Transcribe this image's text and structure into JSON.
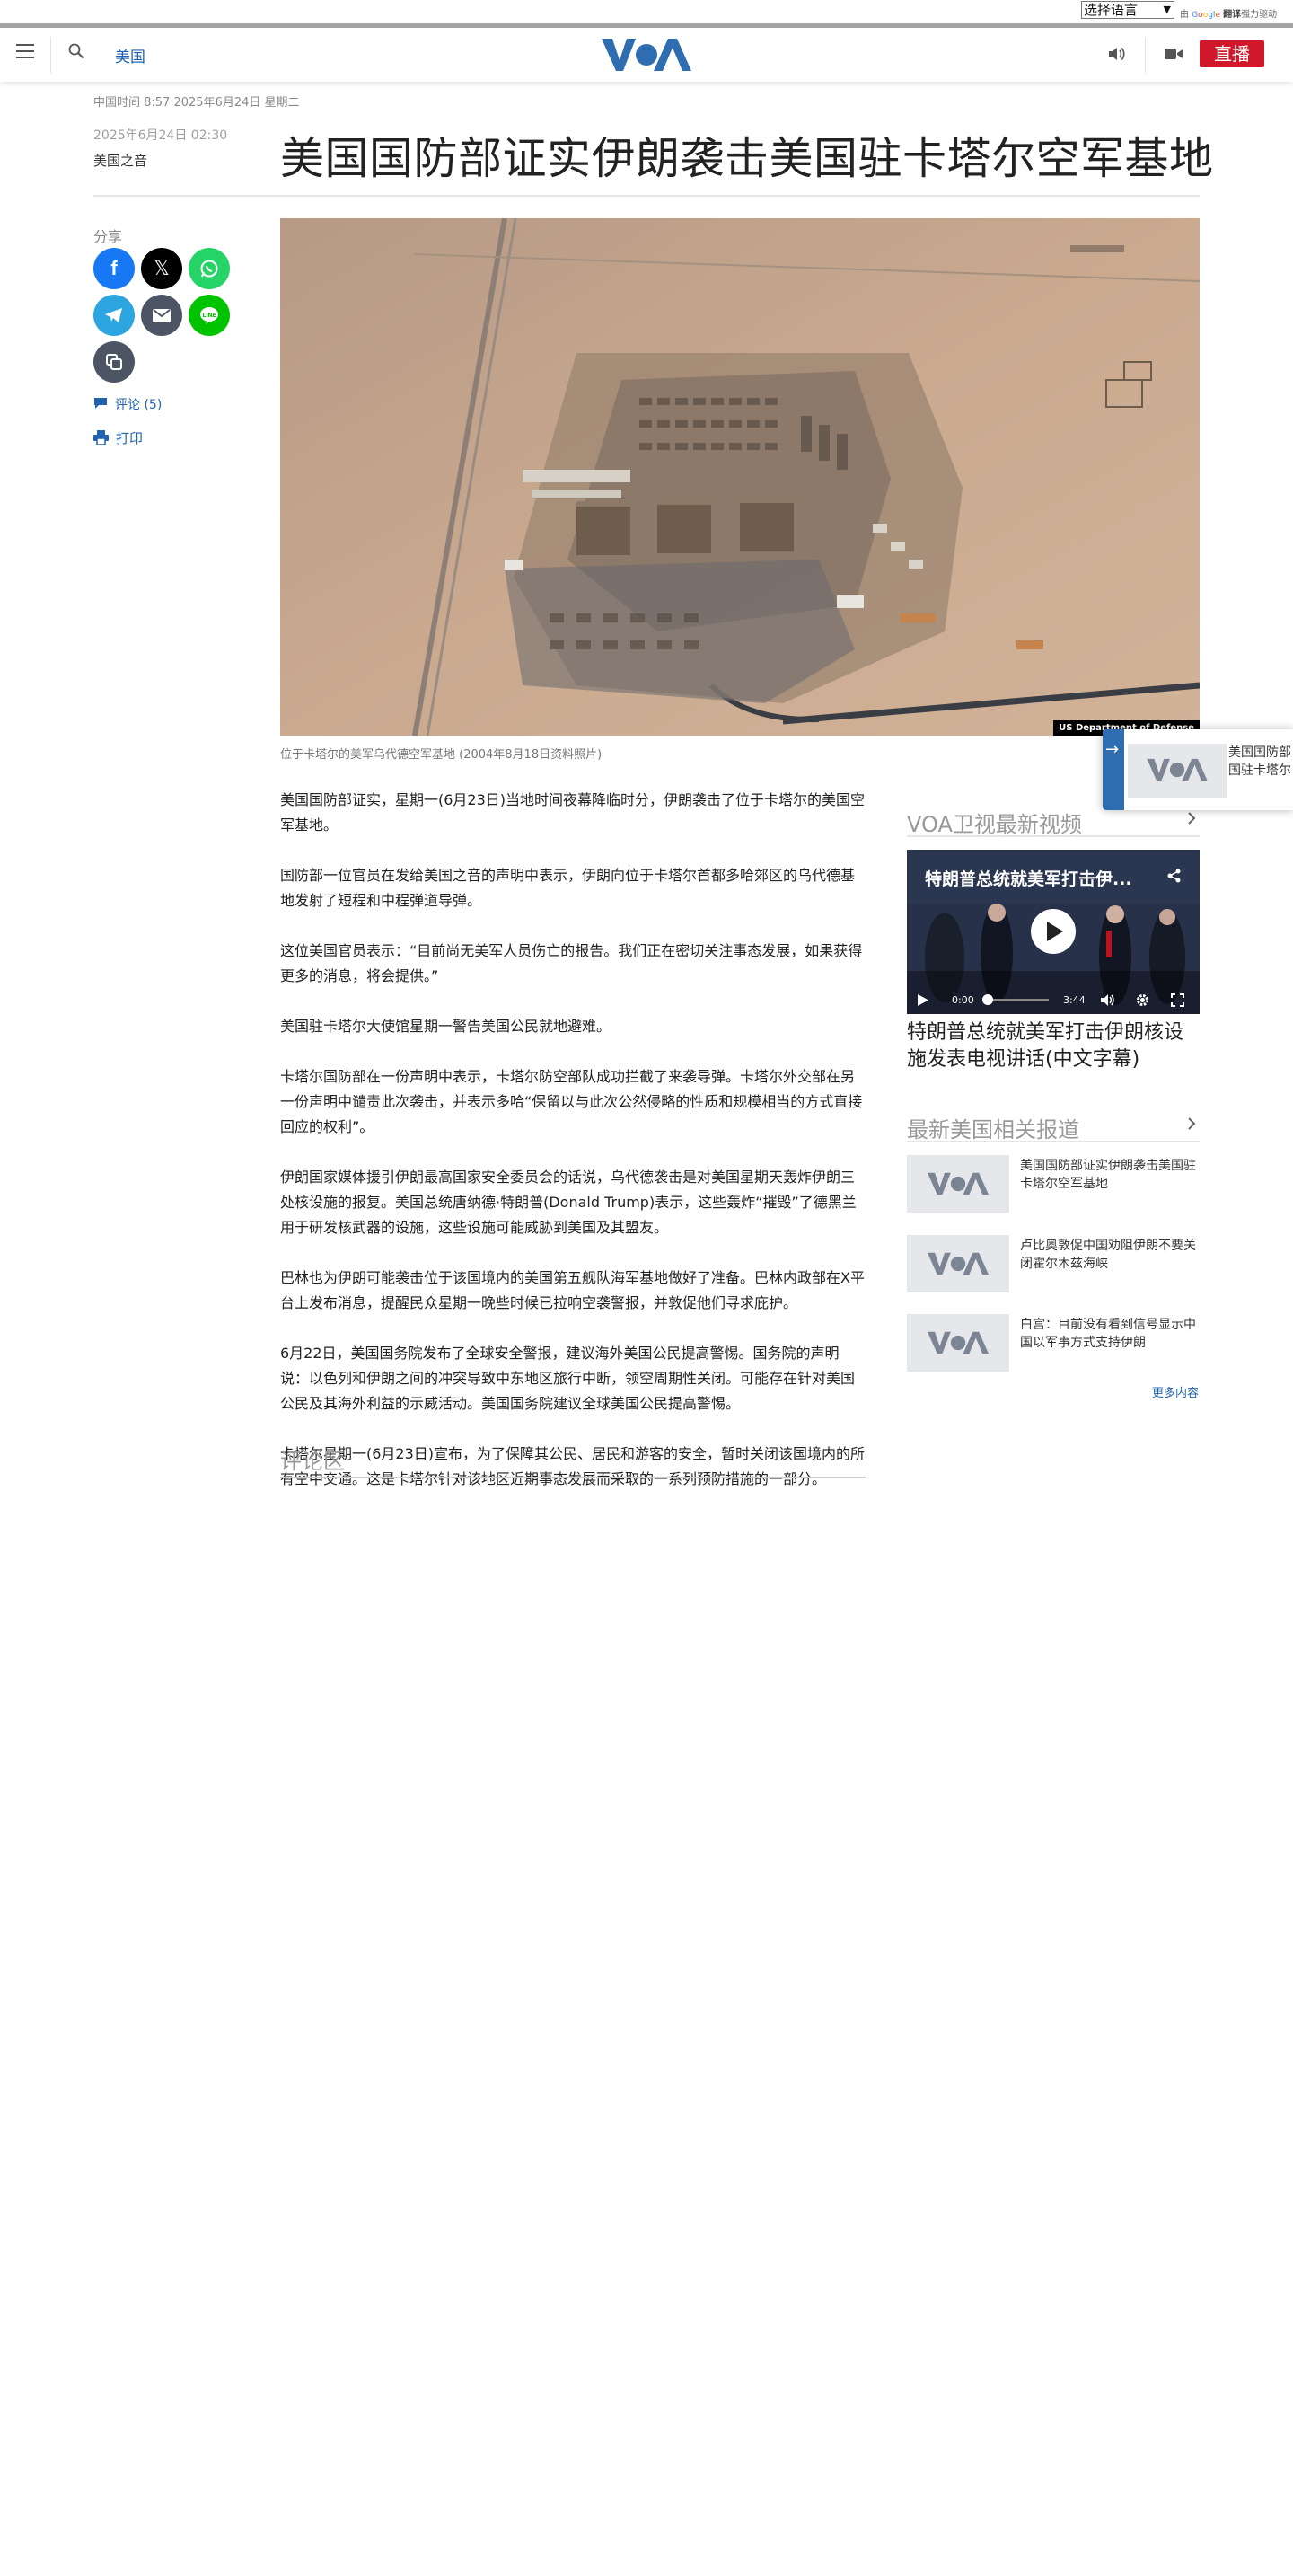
{
  "translate_bar": {
    "select_label": "选择语言",
    "by": "由",
    "google": "Google",
    "translate": "翻译",
    "powered": "强力驱动"
  },
  "header": {
    "section": "美国",
    "live": "直播"
  },
  "article": {
    "datetime": "中国时间 8:57 2025年6月24日 星期二",
    "pub_date": "2025年6月24日 02:30",
    "author": "美国之音",
    "headline": "美国国防部证实伊朗袭击美国驻卡塔尔空军基地",
    "photo_credit": "US Department of Defense",
    "caption": "位于卡塔尔的美军乌代德空军基地 (2004年8月18日资料照片)",
    "paragraphs": [
      "美国国防部证实，星期一(6月23日)当地时间夜幕降临时分，伊朗袭击了位于卡塔尔的美国空军基地。",
      "国防部一位官员在发给美国之音的声明中表示，伊朗向位于卡塔尔首都多哈郊区的乌代德基地发射了短程和中程弹道导弹。",
      "这位美国官员表示：“目前尚无美军人员伤亡的报告。我们正在密切关注事态发展，如果获得更多的消息，将会提供。”",
      "美国驻卡塔尔大使馆星期一警告美国公民就地避难。",
      "卡塔尔国防部在一份声明中表示，卡塔尔防空部队成功拦截了来袭导弹。卡塔尔外交部在另一份声明中谴责此次袭击，并表示多哈“保留以与此次公然侵略的性质和规模相当的方式直接回应的权利”。",
      "伊朗国家媒体援引伊朗最高国家安全委员会的话说，乌代德袭击是对美国星期天轰炸伊朗三处核设施的报复。美国总统唐纳德·特朗普(Donald Trump)表示，这些轰炸“摧毁”了德黑兰用于研发核武器的设施，这些设施可能威胁到美国及其盟友。",
      "巴林也为伊朗可能袭击位于该国境内的美国第五舰队海军基地做好了准备。巴林内政部在X平台上发布消息，提醒民众星期一晚些时候已拉响空袭警报，并敦促他们寻求庇护。",
      "6月22日，美国国务院发布了全球安全警报，建议海外美国公民提高警惕。国务院的声明说：以色列和伊朗之间的冲突导致中东地区旅行中断，领空周期性关闭。可能存在针对美国公民及其海外利益的示威活动。美国国务院建议全球美国公民提高警惕。",
      "卡塔尔星期一(6月23日)宣布，为了保障其公民、居民和游客的安全，暂时关闭该国境内的所有空中交通。这是卡塔尔针对该地区近期事态发展而采取的一系列预防措施的一部分。"
    ],
    "comments_heading": "评论区"
  },
  "share": {
    "label": "分享",
    "comments": "评论 (5)",
    "print": "打印",
    "buttons": [
      {
        "name": "facebook",
        "color": "#1877f2"
      },
      {
        "name": "x",
        "color": "#000000"
      },
      {
        "name": "whatsapp",
        "color": "#25d366"
      },
      {
        "name": "telegram",
        "color": "#2ca5e0"
      },
      {
        "name": "email",
        "color": "#4b5563"
      },
      {
        "name": "line",
        "color": "#00c300"
      },
      {
        "name": "copy-link",
        "color": "#4b5563"
      }
    ]
  },
  "rail": {
    "video_section": "VOA卫视最新视频",
    "video": {
      "overlay_title": "特朗普总统就美军打击伊...",
      "time_current": "0:00",
      "time_total": "3:44",
      "title": "特朗普总统就美军打击伊朗核设施发表电视讲话(中文字幕)"
    },
    "related_section": "最新美国相关报道",
    "related": [
      {
        "title": "美国国防部证实伊朗袭击美国驻卡塔尔空军基地"
      },
      {
        "title": "卢比奥敦促中国劝阻伊朗不要关闭霍尔木兹海峡"
      },
      {
        "title": "白宫：目前没有看到信号显示中国以军事方式支持伊朗"
      }
    ],
    "more": "更多内容"
  },
  "floating": {
    "text_line1": "美国国防部",
    "text_line2": "国驻卡塔尔"
  },
  "colors": {
    "voa_blue": "#2f6db1",
    "live_red": "#d0182a",
    "link_blue": "#1f63b1"
  }
}
